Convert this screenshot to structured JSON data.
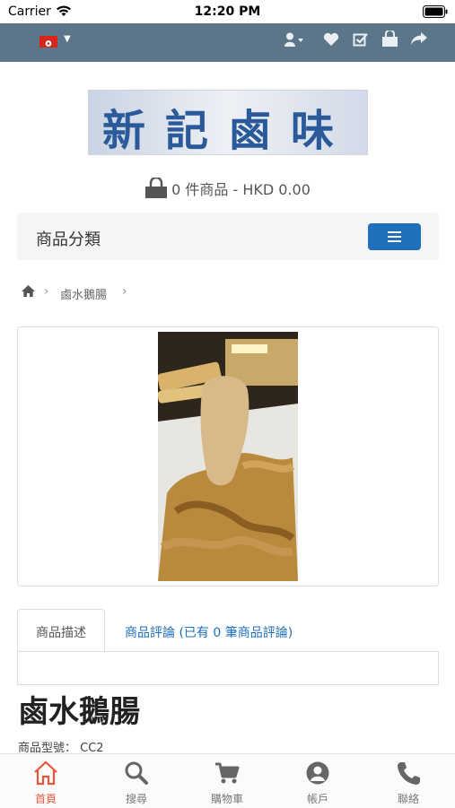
{
  "status_bar": {
    "carrier": "Carrier",
    "time": "12:20 PM"
  },
  "logo_text": "新記鹵味",
  "cart": {
    "summary": "0 件商品 - HKD 0.00"
  },
  "category": {
    "title": "商品分類"
  },
  "breadcrumb": {
    "current": "鹵水鵝腸"
  },
  "tabs": {
    "description": "商品描述",
    "reviews": "商品評論 (已有 0 筆商品評論)"
  },
  "product": {
    "title": "鹵水鵝腸",
    "model_label": "商品型號：",
    "model_value": "CC2"
  },
  "bottom_nav": [
    {
      "label": "首頁",
      "icon": "home-icon",
      "active": true
    },
    {
      "label": "搜尋",
      "icon": "search-icon",
      "active": false
    },
    {
      "label": "購物車",
      "icon": "cart-icon",
      "active": false
    },
    {
      "label": "帳戶",
      "icon": "account-icon",
      "active": false
    },
    {
      "label": "聯絡",
      "icon": "phone-icon",
      "active": false
    }
  ],
  "colors": {
    "nav_bg": "#5c7689",
    "accent": "#1f6fbd",
    "active_tab": "#e8573c"
  }
}
